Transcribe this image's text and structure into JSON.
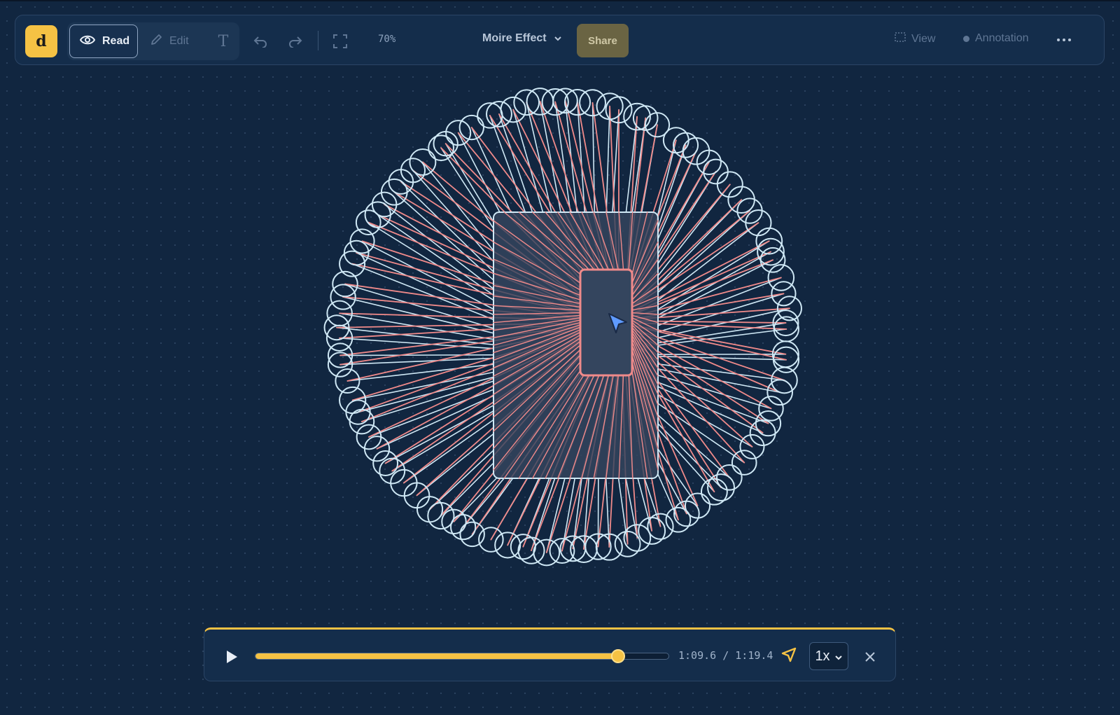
{
  "app": {
    "logo_letter": "d",
    "accent_color": "#f5c244",
    "background_color": "#112640"
  },
  "toolbar": {
    "read_label": "Read",
    "edit_label": "Edit",
    "text_tool_glyph": "T",
    "zoom_label": "70%",
    "document_title": "Moire Effect",
    "share_label": "Share",
    "view_label": "View",
    "annotation_label": "Annotation",
    "icons": [
      "eye-icon",
      "pencil-icon",
      "text-icon",
      "undo-icon",
      "redo-icon",
      "fullscreen-icon",
      "chevron-down-icon",
      "frame-icon",
      "more-icon"
    ]
  },
  "canvas": {
    "drawing_title": "",
    "colors": {
      "outline": "#cfe8f5",
      "rays": "#f08a8a",
      "rect_fill": "#34455e"
    }
  },
  "player": {
    "current_time": "1:09.6",
    "separator": "/",
    "total_time": "1:19.4",
    "progress_fraction": 0.877,
    "speed_label": "1x",
    "icons": [
      "play-icon",
      "cursor-toggle-icon",
      "chevron-down-icon",
      "close-icon"
    ]
  }
}
